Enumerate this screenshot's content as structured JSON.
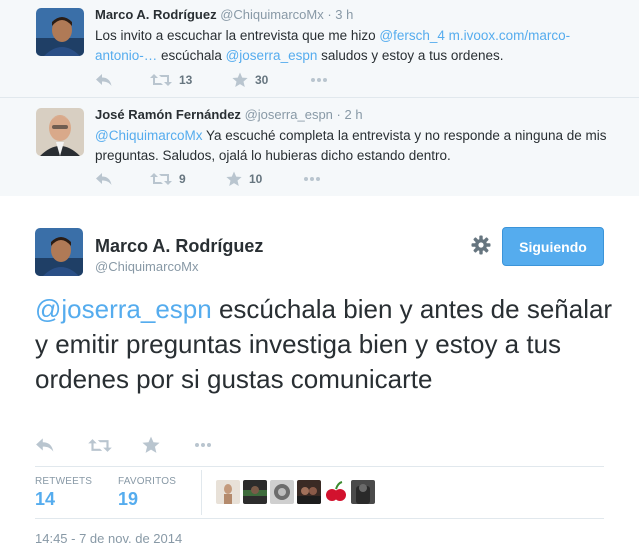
{
  "context_tweets": [
    {
      "fullname": "Marco A. Rodríguez",
      "handle": "@ChiquimarcoMx",
      "time": "· 3 h",
      "text_parts": [
        "Los invito a escuchar la entrevista que me hizo ",
        "@fersch_4",
        " ",
        "m.ivoox.com/marco-antonio-…",
        " escúchala ",
        "@joserra_espn",
        " saludos y estoy a tus ordenes."
      ],
      "retweets": "13",
      "favorites": "30"
    },
    {
      "fullname": "José Ramón Fernández",
      "handle": "@joserra_espn",
      "time": "· 2 h",
      "text_parts": [
        "@ChiquimarcoMx",
        " Ya escuché completa la entrevista y no responde a ninguna de mis preguntas. Saludos, ojalá lo hubieras dicho estando dentro."
      ],
      "retweets": "9",
      "favorites": "10"
    }
  ],
  "main_tweet": {
    "fullname": "Marco A. Rodríguez",
    "handle": "@ChiquimarcoMx",
    "follow_label": "Siguiendo",
    "text_mention": "@joserra_espn",
    "text_body": " escúchala bien y antes de señalar y emitir preguntas investiga bien y estoy a tus ordenes por si gustas comunicarte",
    "stats": {
      "retweets_label": "RETWEETS",
      "retweets_value": "14",
      "favorites_label": "FAVORITOS",
      "favorites_value": "19"
    },
    "timestamp": "14:45 - 7 de nov. de 2014"
  },
  "icons": {
    "reply": "reply-icon",
    "retweet": "retweet-icon",
    "favorite": "star-icon",
    "more": "more-icon",
    "settings": "gear-icon"
  },
  "colors": {
    "link": "#55acee",
    "muted": "#8899a6",
    "context_bg": "#f5f8fa",
    "follow_button": "#55acee"
  }
}
